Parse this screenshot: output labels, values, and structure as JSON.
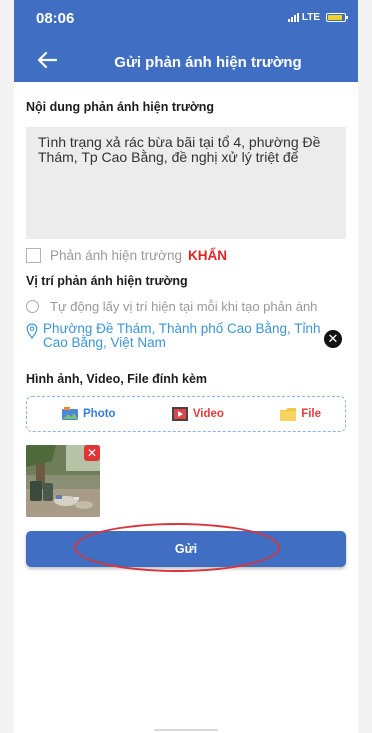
{
  "status_bar": {
    "time": "08:06",
    "network": "LTE",
    "battery_level": 0.85,
    "battery_color": "#f2d32d"
  },
  "header": {
    "title": "Gửi phản ánh hiện trường",
    "back_icon": "arrow-left-icon",
    "color": "#3f6ec2"
  },
  "form": {
    "content_label": "Nội dung phản ánh hiện trường",
    "content_value": "Tình trạng xả rác bừa bãi tại tổ 4, phường Đề Thám, Tp Cao Bằng, đề nghị xử lý triệt để",
    "urgent_label": "Phản ánh hiện trường",
    "urgent_tag": "KHẨN",
    "urgent_checked": false,
    "location_label": "Vị trí phản ánh hiện trường",
    "auto_location_label": "Tự động lấy vị trí hiện tại mỗi khi tạo phản ánh",
    "auto_location_selected": false,
    "location_value": "Phường Đề Thám, Thành phố Cao Bằng, Tỉnh Cao Bằng, Việt Nam",
    "attachments_label": "Hình ảnh, Video, File đính kèm",
    "attach_buttons": {
      "photo": "Photo",
      "video": "Video",
      "file": "File"
    },
    "submit_label": "Gửi"
  },
  "colors": {
    "primary": "#3f6ec2",
    "urgent": "#e12424",
    "link": "#3a95d6",
    "annotation": "#d8343b"
  }
}
